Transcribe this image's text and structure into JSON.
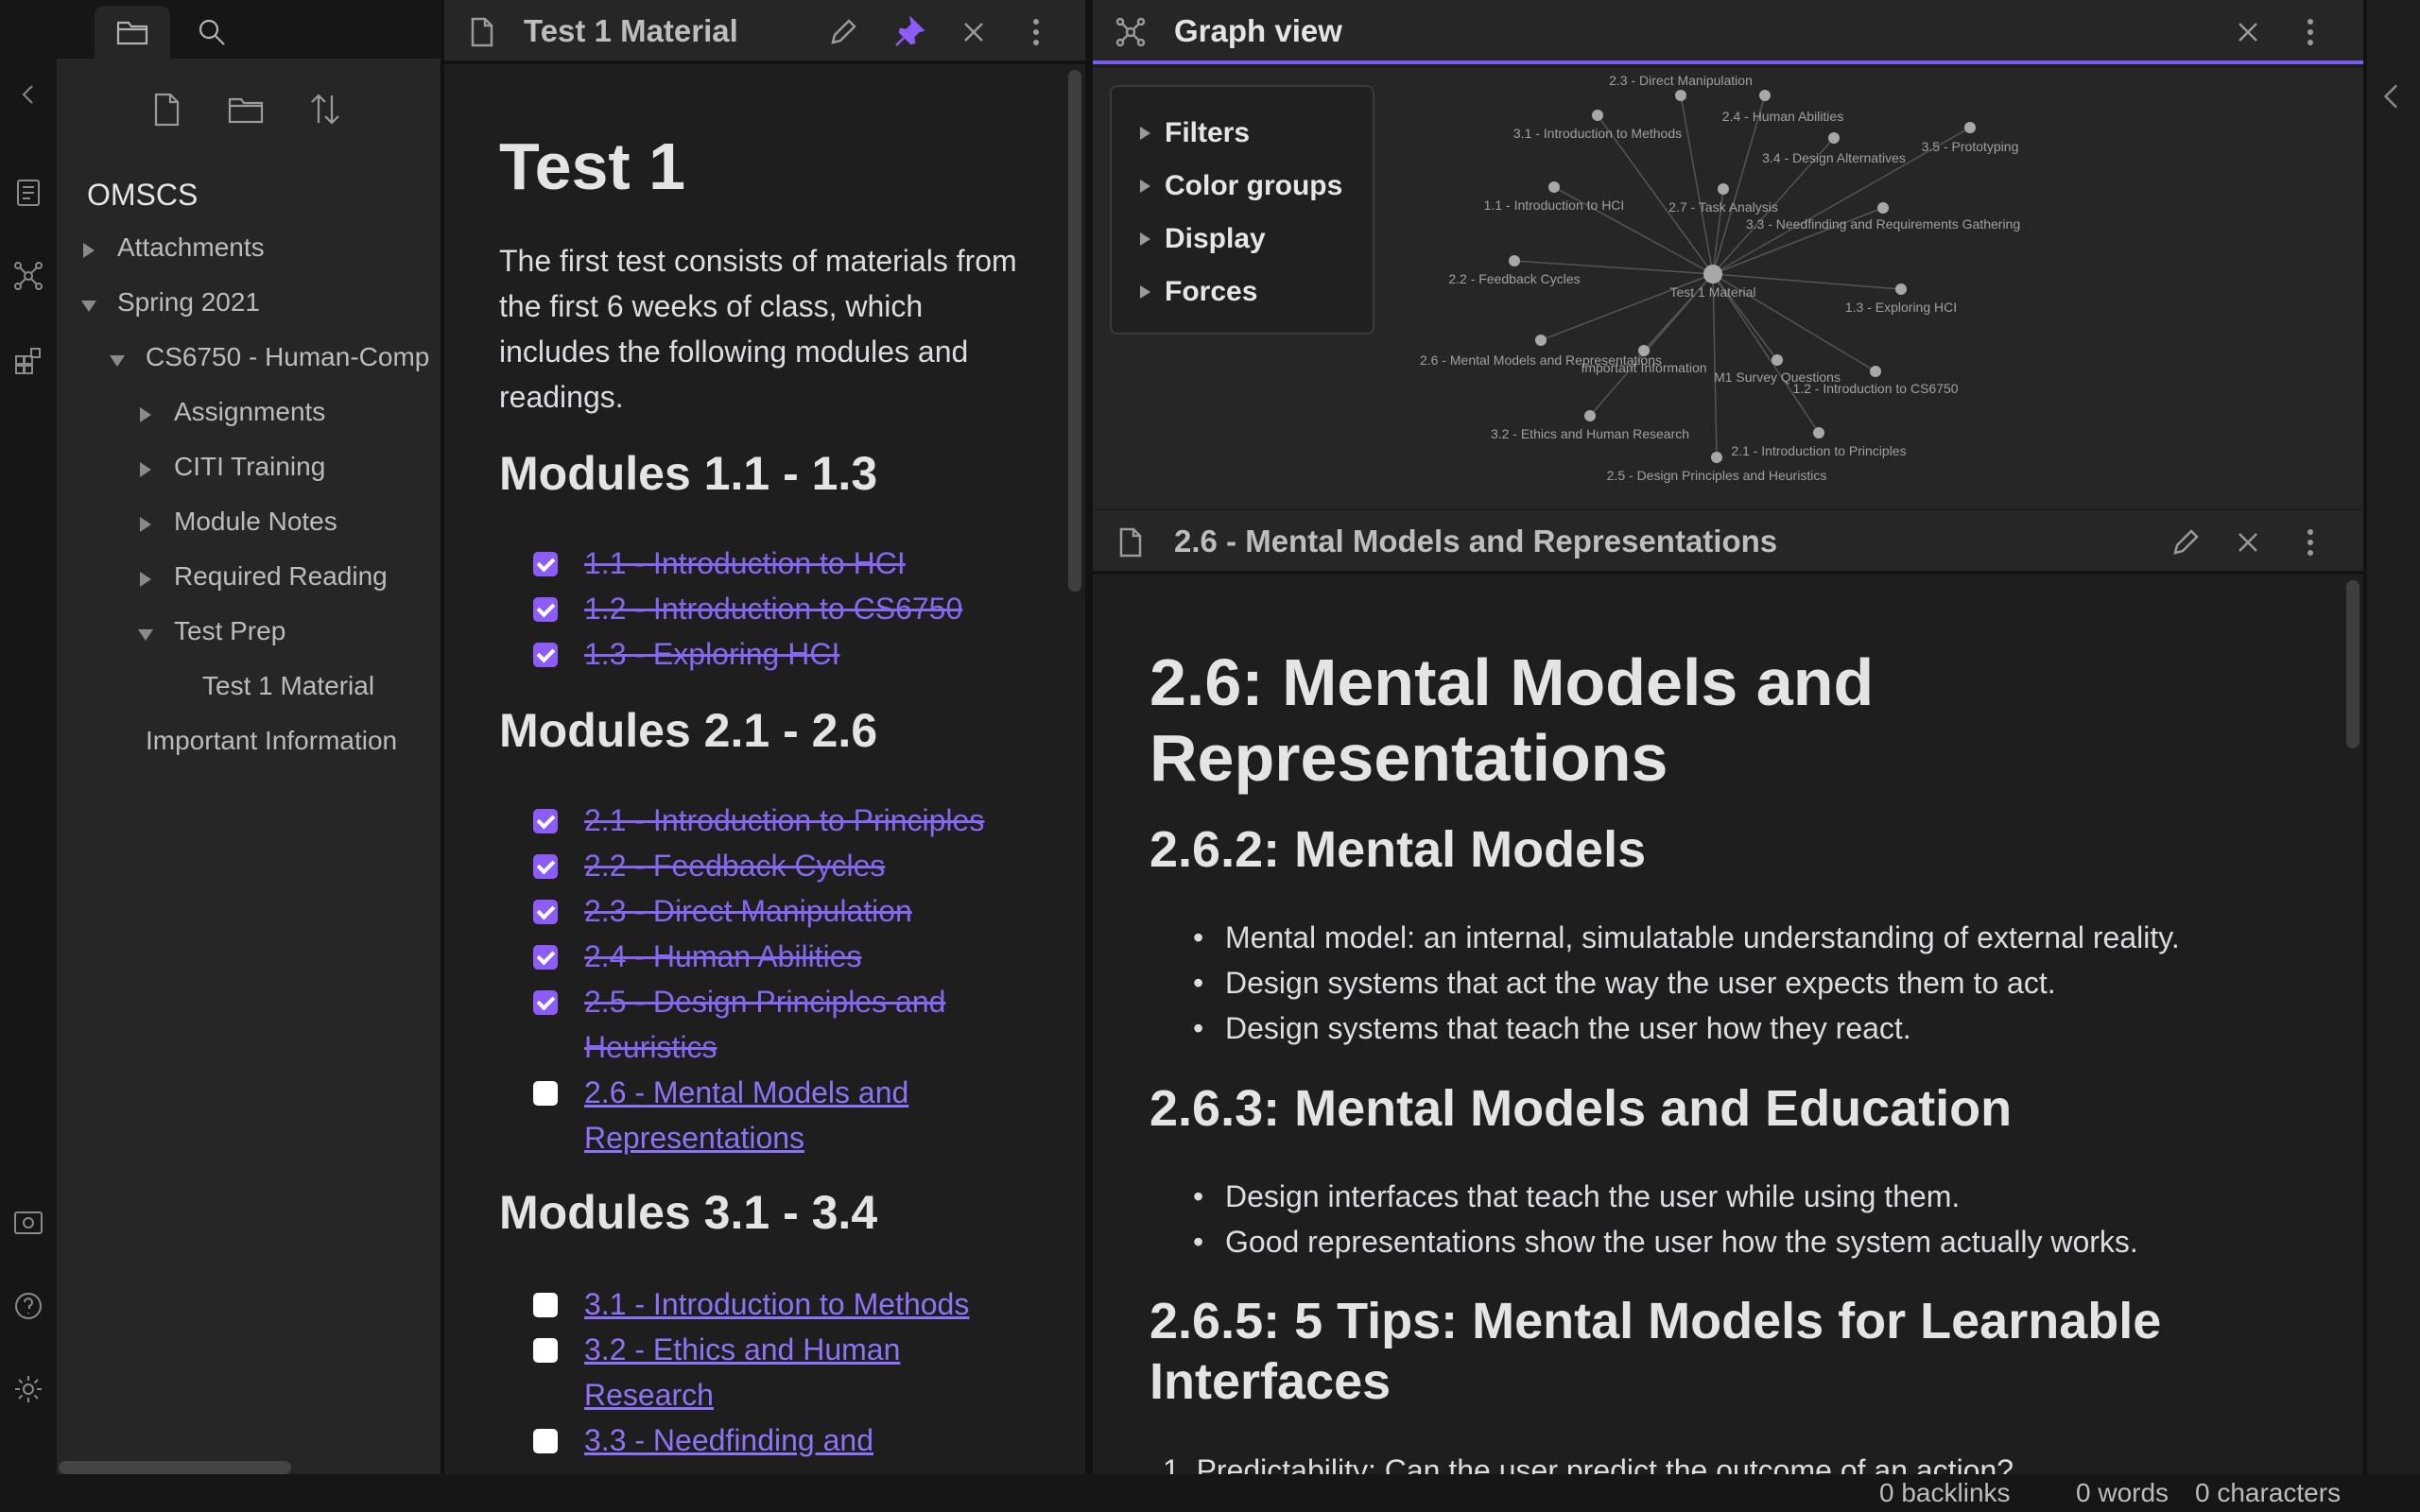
{
  "sidebar": {
    "vault_name": "OMSCS",
    "tree": [
      {
        "label": "Attachments",
        "state": "collapsed"
      },
      {
        "label": "Spring 2021",
        "state": "expanded"
      },
      {
        "label": "CS6750 - Human-Comp",
        "state": "expanded"
      },
      {
        "label": "Assignments",
        "state": "collapsed"
      },
      {
        "label": "CITI Training",
        "state": "collapsed"
      },
      {
        "label": "Module Notes",
        "state": "collapsed"
      },
      {
        "label": "Required Reading",
        "state": "collapsed"
      },
      {
        "label": "Test Prep",
        "state": "expanded"
      },
      {
        "label": "Test 1 Material",
        "state": "file"
      },
      {
        "label": "Important Information",
        "state": "file"
      }
    ]
  },
  "left_pane": {
    "tab_title": "Test 1 Material",
    "h1": "Test 1",
    "intro": "The first test consists of materials from the first 6 weeks of class, which includes the following modules and readings.",
    "sections": [
      {
        "heading": "Modules 1.1 - 1.3",
        "tasks": [
          {
            "label": "1.1 - Introduction to HCI",
            "done": true
          },
          {
            "label": "1.2 - Introduction to CS6750",
            "done": true
          },
          {
            "label": "1.3 - Exploring HCI",
            "done": true
          }
        ]
      },
      {
        "heading": "Modules 2.1 - 2.6",
        "tasks": [
          {
            "label": "2.1 - Introduction to Principles",
            "done": true
          },
          {
            "label": "2.2 - Feedback Cycles",
            "done": true
          },
          {
            "label": "2.3 - Direct Manipulation",
            "done": true
          },
          {
            "label": "2.4 - Human Abilities",
            "done": true
          },
          {
            "label": "2.5 - Design Principles and Heuristics",
            "done": true
          },
          {
            "label": "2.6 - Mental Models and Representations",
            "done": false
          }
        ]
      },
      {
        "heading": "Modules 3.1 - 3.4",
        "tasks": [
          {
            "label": "3.1 - Introduction to Methods",
            "done": false
          },
          {
            "label": "3.2 - Ethics and Human Research",
            "done": false
          },
          {
            "label": "3.3 - Needfinding and",
            "done": false
          }
        ]
      }
    ]
  },
  "graph_pane": {
    "tab_title": "Graph view",
    "filters": [
      "Filters",
      "Color groups",
      "Display",
      "Forces"
    ],
    "center_node": "Test 1 Material",
    "nodes": [
      "2.3 - Direct Manipulation",
      "2.4 - Human Abilities",
      "3.1 - Introduction to Methods",
      "3.4 - Design Alternatives",
      "3.5 - Prototyping",
      "1.1 - Introduction to HCI",
      "2.7 - Task Analysis",
      "3.3 - Needfinding and Requirements Gathering",
      "2.2 - Feedback Cycles",
      "Test 1 Material",
      "1.3 - Exploring HCI",
      "2.6 - Mental Models and Representations",
      "Important Information",
      "M1 Survey Questions",
      "1.2 - Introduction to CS6750",
      "3.2 - Ethics and Human Research",
      "2.1 - Introduction to Principles",
      "2.5 - Design Principles and Heuristics"
    ]
  },
  "right_pane": {
    "tab_title": "2.6 - Mental Models and Representations",
    "h1": "2.6: Mental Models and Representations",
    "sec1": {
      "heading": "2.6.2: Mental Models",
      "bullets": [
        "Mental model: an internal, simulatable understanding of external reality.",
        "Design systems that act the way the user expects them to act.",
        "Design systems that teach the user how they react."
      ]
    },
    "sec2": {
      "heading": "2.6.3: Mental Models and Education",
      "bullets": [
        "Design interfaces that teach the user while using them.",
        "Good representations show the user how the system actually works."
      ]
    },
    "sec3": {
      "heading": "2.6.5: 5 Tips: Mental Models for Learnable Interfaces",
      "first_item": "1. Predictability: Can the user predict the outcome of an action?"
    }
  },
  "status": {
    "backlinks": "0 backlinks",
    "words": "0 words",
    "characters": "0 characters"
  },
  "colors": {
    "accent": "#8c5cf5",
    "link": "#8f73f7"
  }
}
